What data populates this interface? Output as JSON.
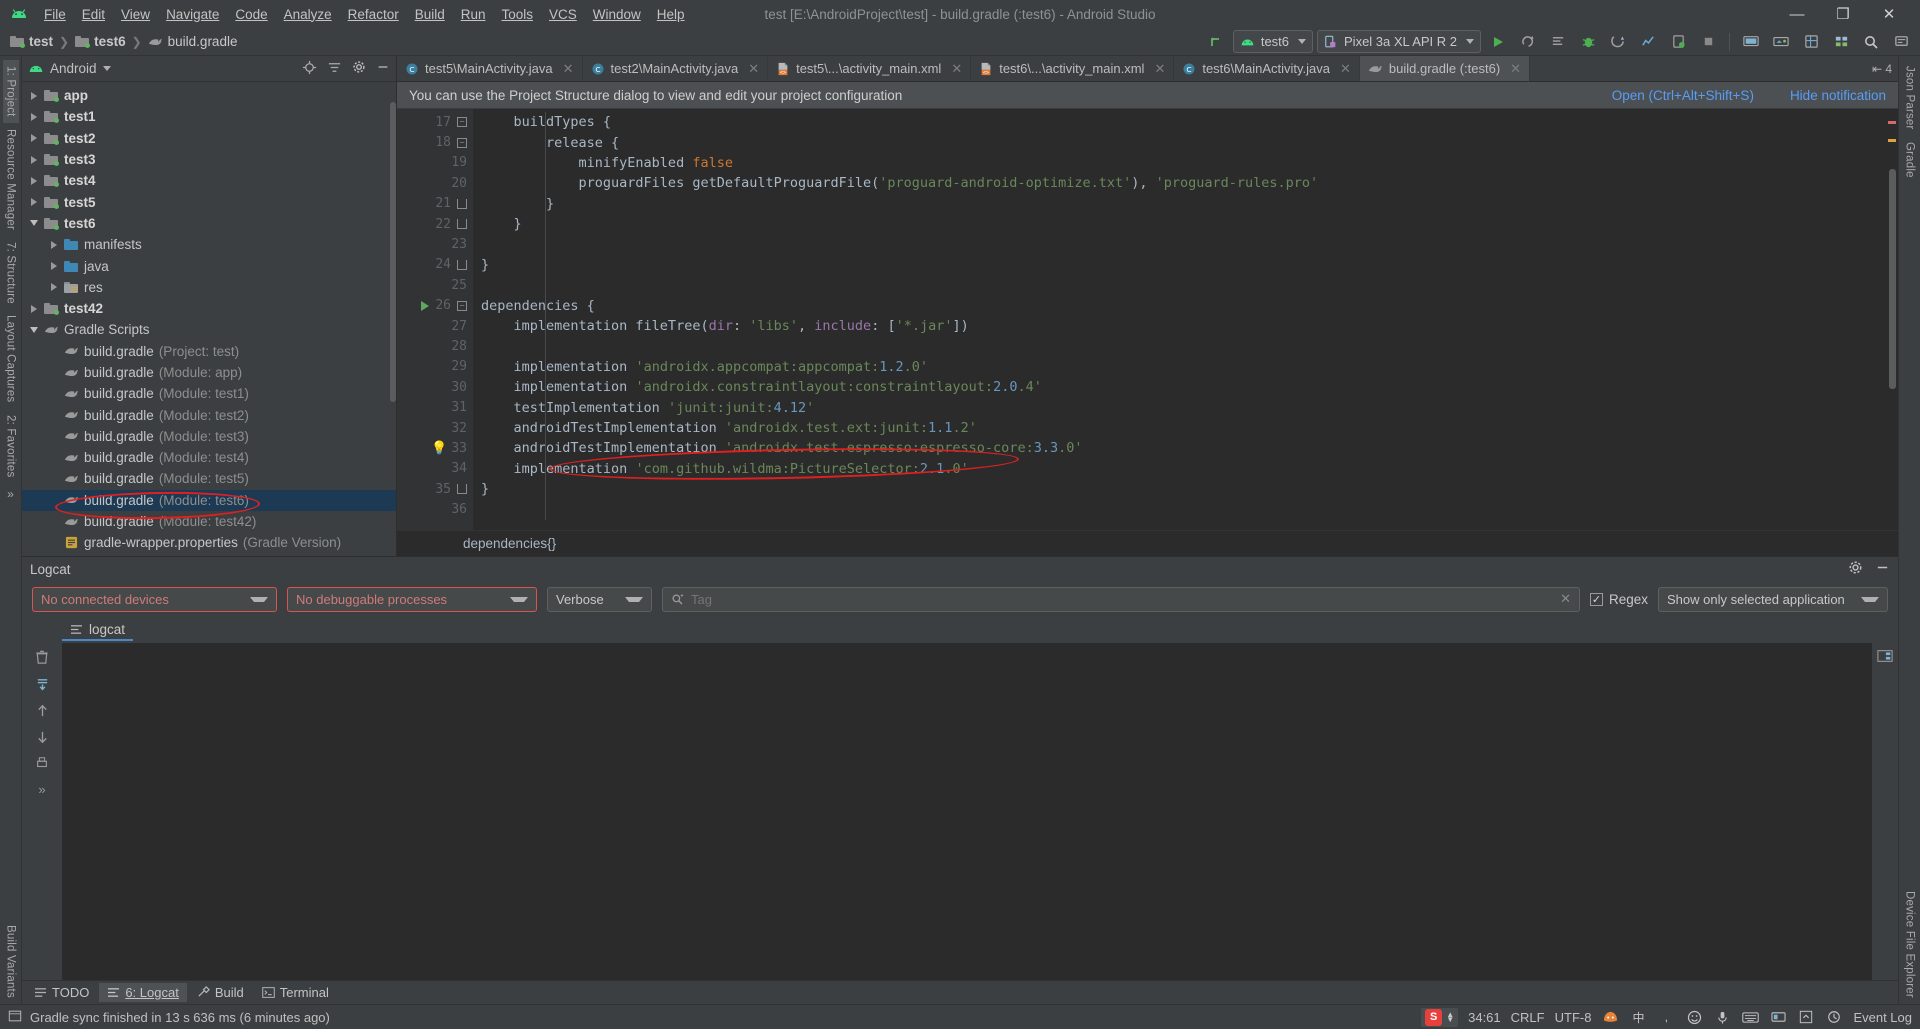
{
  "window": {
    "title": "test [E:\\AndroidProject\\test] - build.gradle (:test6) - Android Studio",
    "minimize": "—",
    "maximize": "❐",
    "close": "✕"
  },
  "menu": [
    "File",
    "Edit",
    "View",
    "Navigate",
    "Code",
    "Analyze",
    "Refactor",
    "Build",
    "Run",
    "Tools",
    "VCS",
    "Window",
    "Help"
  ],
  "navbar": {
    "crumbs": [
      {
        "label": "test",
        "icon": "folder-icon",
        "bold": true
      },
      {
        "label": "test6",
        "icon": "folder-icon",
        "bold": true
      },
      {
        "label": "build.gradle",
        "icon": "gradle-icon",
        "bold": false
      }
    ],
    "separator": "❯",
    "run_config": "test6",
    "device": "Pixel 3a XL API R 2",
    "icons": [
      "sync-icon",
      "run-icon",
      "apply-changes-icon",
      "apply-code-changes-icon",
      "debug-icon",
      "attach-debugger-icon",
      "profiler-icon",
      "device-manager-icon",
      "stop-icon",
      "avd-manager-icon",
      "sdk-manager-icon",
      "layout-inspector-icon",
      "project-structure-icon",
      "search-icon",
      "notifications-icon"
    ]
  },
  "left_strip": [
    {
      "label": "1: Project",
      "active": true
    },
    {
      "label": "Resource Manager",
      "active": false
    },
    {
      "label": "7: Structure",
      "active": false
    },
    {
      "label": "Layout Captures",
      "active": false
    },
    {
      "label": "2: Favorites",
      "active": false
    },
    {
      "label": "Build Variants",
      "active": false
    }
  ],
  "right_strip": [
    {
      "label": "Json Parser"
    },
    {
      "label": "Gradle"
    },
    {
      "label": "Device File Explorer"
    }
  ],
  "project_panel": {
    "view": "Android",
    "header_icons": [
      "locate-icon",
      "collapse-all-icon",
      "settings-icon",
      "hide-icon"
    ],
    "tree": [
      {
        "indent": 0,
        "arrow": "right",
        "icon": "module-folder",
        "label": "app",
        "bold": true,
        "dim": "",
        "selected": false
      },
      {
        "indent": 0,
        "arrow": "right",
        "icon": "module-folder",
        "label": "test1",
        "bold": true,
        "dim": "",
        "selected": false
      },
      {
        "indent": 0,
        "arrow": "right",
        "icon": "module-folder",
        "label": "test2",
        "bold": true,
        "dim": "",
        "selected": false
      },
      {
        "indent": 0,
        "arrow": "right",
        "icon": "module-folder",
        "label": "test3",
        "bold": true,
        "dim": "",
        "selected": false
      },
      {
        "indent": 0,
        "arrow": "right",
        "icon": "module-folder",
        "label": "test4",
        "bold": true,
        "dim": "",
        "selected": false
      },
      {
        "indent": 0,
        "arrow": "right",
        "icon": "module-folder",
        "label": "test5",
        "bold": true,
        "dim": "",
        "selected": false
      },
      {
        "indent": 0,
        "arrow": "down",
        "icon": "module-folder",
        "label": "test6",
        "bold": true,
        "dim": "",
        "selected": false
      },
      {
        "indent": 1,
        "arrow": "right",
        "icon": "blue-folder",
        "label": "manifests",
        "bold": false,
        "dim": "",
        "selected": false
      },
      {
        "indent": 1,
        "arrow": "right",
        "icon": "blue-folder",
        "label": "java",
        "bold": false,
        "dim": "",
        "selected": false
      },
      {
        "indent": 1,
        "arrow": "right",
        "icon": "res-folder",
        "label": "res",
        "bold": false,
        "dim": "",
        "selected": false
      },
      {
        "indent": 0,
        "arrow": "right",
        "icon": "module-folder",
        "label": "test42",
        "bold": true,
        "dim": "",
        "selected": false
      },
      {
        "indent": 0,
        "arrow": "down",
        "icon": "gradle-icon",
        "label": "Gradle Scripts",
        "bold": false,
        "dim": "",
        "selected": false
      },
      {
        "indent": 1,
        "arrow": "none",
        "icon": "gradle-icon",
        "label": "build.gradle",
        "bold": false,
        "dim": "(Project: test)",
        "selected": false
      },
      {
        "indent": 1,
        "arrow": "none",
        "icon": "gradle-icon",
        "label": "build.gradle",
        "bold": false,
        "dim": "(Module: app)",
        "selected": false
      },
      {
        "indent": 1,
        "arrow": "none",
        "icon": "gradle-icon",
        "label": "build.gradle",
        "bold": false,
        "dim": "(Module: test1)",
        "selected": false
      },
      {
        "indent": 1,
        "arrow": "none",
        "icon": "gradle-icon",
        "label": "build.gradle",
        "bold": false,
        "dim": "(Module: test2)",
        "selected": false
      },
      {
        "indent": 1,
        "arrow": "none",
        "icon": "gradle-icon",
        "label": "build.gradle",
        "bold": false,
        "dim": "(Module: test3)",
        "selected": false
      },
      {
        "indent": 1,
        "arrow": "none",
        "icon": "gradle-icon",
        "label": "build.gradle",
        "bold": false,
        "dim": "(Module: test4)",
        "selected": false
      },
      {
        "indent": 1,
        "arrow": "none",
        "icon": "gradle-icon",
        "label": "build.gradle",
        "bold": false,
        "dim": "(Module: test5)",
        "selected": false
      },
      {
        "indent": 1,
        "arrow": "none",
        "icon": "gradle-icon",
        "label": "build.gradle",
        "bold": false,
        "dim": "(Module: test6)",
        "selected": true
      },
      {
        "indent": 1,
        "arrow": "none",
        "icon": "gradle-icon",
        "label": "build.gradle",
        "bold": false,
        "dim": "(Module: test42)",
        "selected": false
      },
      {
        "indent": 1,
        "arrow": "none",
        "icon": "properties-icon",
        "label": "gradle-wrapper.properties",
        "bold": false,
        "dim": "(Gradle Version)",
        "selected": false
      }
    ]
  },
  "editor": {
    "tabs": [
      {
        "label": "test5\\MainActivity.java",
        "icon": "java-class-icon",
        "active": false
      },
      {
        "label": "test2\\MainActivity.java",
        "icon": "java-class-icon",
        "active": false
      },
      {
        "label": "test5\\...\\activity_main.xml",
        "icon": "layout-xml-icon",
        "active": false
      },
      {
        "label": "test6\\...\\activity_main.xml",
        "icon": "layout-xml-icon",
        "active": false
      },
      {
        "label": "test6\\MainActivity.java",
        "icon": "java-class-icon",
        "active": false
      },
      {
        "label": "build.gradle (:test6)",
        "icon": "gradle-icon",
        "active": true
      }
    ],
    "tab_overflow": "⇤ 4",
    "notification": {
      "message": "You can use the Project Structure dialog to view and edit your project configuration",
      "action": "Open (Ctrl+Alt+Shift+S)",
      "hide": "Hide notification"
    },
    "breadcrumb": "dependencies{}",
    "first_line_number": 17,
    "lines": [
      {
        "n": 17,
        "fold": "minus",
        "gutter_icon": "",
        "text": "    buildTypes {"
      },
      {
        "n": 18,
        "fold": "minus",
        "gutter_icon": "",
        "text": "        release {"
      },
      {
        "n": 19,
        "fold": "",
        "gutter_icon": "",
        "text": "            minifyEnabled false"
      },
      {
        "n": 20,
        "fold": "",
        "gutter_icon": "",
        "text": "            proguardFiles getDefaultProguardFile('proguard-android-optimize.txt'), 'proguard-rules.pro'"
      },
      {
        "n": 21,
        "fold": "end",
        "gutter_icon": "",
        "text": "        }"
      },
      {
        "n": 22,
        "fold": "end",
        "gutter_icon": "",
        "text": "    }"
      },
      {
        "n": 23,
        "fold": "",
        "gutter_icon": "",
        "text": ""
      },
      {
        "n": 24,
        "fold": "end",
        "gutter_icon": "",
        "text": "}"
      },
      {
        "n": 25,
        "fold": "",
        "gutter_icon": "",
        "text": ""
      },
      {
        "n": 26,
        "fold": "minus",
        "gutter_icon": "run",
        "text": "dependencies {"
      },
      {
        "n": 27,
        "fold": "",
        "gutter_icon": "",
        "text": "    implementation fileTree(dir: 'libs', include: ['*.jar'])"
      },
      {
        "n": 28,
        "fold": "",
        "gutter_icon": "",
        "text": ""
      },
      {
        "n": 29,
        "fold": "",
        "gutter_icon": "",
        "text": "    implementation 'androidx.appcompat:appcompat:1.2.0'"
      },
      {
        "n": 30,
        "fold": "",
        "gutter_icon": "",
        "text": "    implementation 'androidx.constraintlayout:constraintlayout:2.0.4'"
      },
      {
        "n": 31,
        "fold": "",
        "gutter_icon": "",
        "text": "    testImplementation 'junit:junit:4.12'"
      },
      {
        "n": 32,
        "fold": "",
        "gutter_icon": "",
        "text": "    androidTestImplementation 'androidx.test.ext:junit:1.1.2'"
      },
      {
        "n": 33,
        "fold": "",
        "gutter_icon": "bulb",
        "text": "    androidTestImplementation 'androidx.test.espresso:espresso-core:3.3.0'"
      },
      {
        "n": 34,
        "fold": "",
        "gutter_icon": "",
        "text": "    implementation 'com.github.wildma:PictureSelector:2.1.0'"
      },
      {
        "n": 35,
        "fold": "end",
        "gutter_icon": "",
        "text": "}"
      },
      {
        "n": 36,
        "fold": "",
        "gutter_icon": "",
        "text": ""
      }
    ],
    "annotations": [
      {
        "name": "red-ellipse-code-line-34"
      },
      {
        "name": "red-ellipse-tree-build-gradle-test6"
      }
    ]
  },
  "logcat": {
    "title": "Logcat",
    "settings_icon": "gear-icon",
    "minimize_icon": "minimize-icon",
    "device_select": "No connected devices",
    "process_select": "No debuggable processes",
    "level_select": "Verbose",
    "search_placeholder": "Tag",
    "search_value": "",
    "regex_label": "Regex",
    "regex_checked": true,
    "filter_select": "Show only selected application",
    "tab_label": "logcat",
    "side_icons": [
      "clear-icon",
      "scroll-end-icon",
      "up-icon",
      "down-icon",
      "print-icon",
      "more-icon"
    ]
  },
  "bottom_bar": [
    {
      "label": "TODO",
      "icon": "todo-icon",
      "active": false,
      "mnemonic": ""
    },
    {
      "label": "6: Logcat",
      "icon": "logcat-icon",
      "active": true,
      "mnemonic": "6"
    },
    {
      "label": "Build",
      "icon": "build-icon",
      "active": false,
      "mnemonic": ""
    },
    {
      "label": "Terminal",
      "icon": "terminal-icon",
      "active": false,
      "mnemonic": ""
    }
  ],
  "status_bar": {
    "message": "Gradle sync finished in 13 s 636 ms (6 minutes ago)",
    "caret_position": "34:61",
    "line_separator": "CRLF",
    "encoding": "UTF-8",
    "event_log": "Event Log",
    "ime_badge": "S",
    "tray_items": [
      "ime-icon",
      "chinese-icon",
      "keyboard-icon",
      "settings-tray-icon",
      "mic-icon",
      "volume-icon",
      "expand-icon",
      "cloud-icon",
      "shield-icon"
    ]
  },
  "colors": {
    "accent_blue": "#589df6",
    "selection": "#1c3a53",
    "annotation_red": "#e02020",
    "green": "#62b463",
    "string_green": "#6a8759",
    "keyword_orange": "#cc7832",
    "editor_bg": "#2b2b2b",
    "panel_bg": "#3c3f41"
  }
}
